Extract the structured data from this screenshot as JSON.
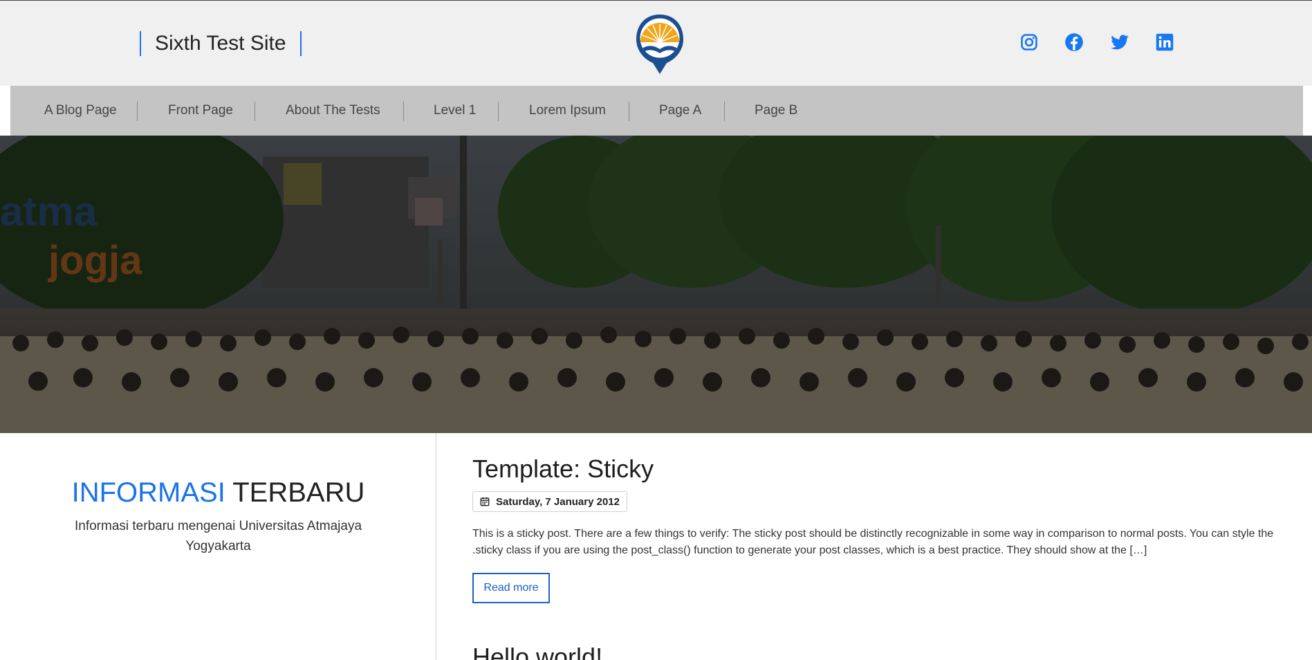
{
  "header": {
    "site_title": "Sixth Test Site",
    "logo_alt": "Universitas Atma Jaya Yogyakarta logo",
    "social": [
      {
        "name": "instagram-icon"
      },
      {
        "name": "facebook-icon"
      },
      {
        "name": "twitter-icon"
      },
      {
        "name": "linkedin-icon"
      }
    ]
  },
  "nav": {
    "items": [
      {
        "label": "A Blog Page"
      },
      {
        "label": "Front Page"
      },
      {
        "label": "About The Tests"
      },
      {
        "label": "Level 1"
      },
      {
        "label": "Lorem Ipsum"
      },
      {
        "label": "Page A"
      },
      {
        "label": "Page B"
      }
    ]
  },
  "sidebar": {
    "title_highlight": "INFORMASI",
    "title_rest": "TERBARU",
    "subtitle": "Informasi terbaru mengenai Universitas Atmajaya Yogyakarta"
  },
  "posts": [
    {
      "title": "Template: Sticky",
      "date": "Saturday, 7 January 2012",
      "excerpt": "This is a sticky post. There are a few things to verify: The sticky post should be distinctly recognizable in some way in comparison to normal posts. You can style the .sticky class if you are using the post_class() function to generate your post classes, which is a best practice. They should show at the […]",
      "read_more": "Read more"
    },
    {
      "title": "Hello world!"
    }
  ],
  "colors": {
    "accent": "#1a73e8",
    "header_bg": "#f0f0f0",
    "nav_bg": "#c4c4c4",
    "social": "#1877f2"
  }
}
